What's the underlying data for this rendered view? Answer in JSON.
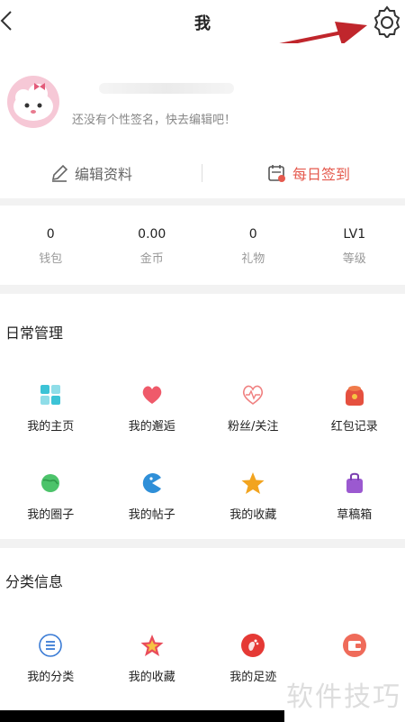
{
  "header": {
    "title": "我"
  },
  "profile": {
    "signature": "还没有个性签名，快去编辑吧！",
    "edit_label": "编辑资料",
    "checkin_label": "每日签到"
  },
  "stats": [
    {
      "value": "0",
      "label": "钱包"
    },
    {
      "value": "0.00",
      "label": "金币"
    },
    {
      "value": "0",
      "label": "礼物"
    },
    {
      "value": "LV1",
      "label": "等级"
    }
  ],
  "daily": {
    "title": "日常管理",
    "items": [
      {
        "label": "我的主页",
        "icon": "home-grid-icon"
      },
      {
        "label": "我的邂逅",
        "icon": "heart-icon"
      },
      {
        "label": "粉丝/关注",
        "icon": "heartbeat-icon"
      },
      {
        "label": "红包记录",
        "icon": "red-packet-icon"
      },
      {
        "label": "我的圈子",
        "icon": "planet-icon"
      },
      {
        "label": "我的帖子",
        "icon": "pacman-icon"
      },
      {
        "label": "我的收藏",
        "icon": "star-icon"
      },
      {
        "label": "草稿箱",
        "icon": "bag-icon"
      }
    ]
  },
  "category": {
    "title": "分类信息",
    "items": [
      {
        "label": "我的分类",
        "icon": "list-icon"
      },
      {
        "label": "我的收藏",
        "icon": "star-badge-icon"
      },
      {
        "label": "我的足迹",
        "icon": "footprint-icon"
      },
      {
        "label": "",
        "icon": "wallet-icon"
      }
    ]
  },
  "watermark": "软件技巧",
  "colors": {
    "accent": "#e55a4e",
    "arrow": "#c0262c"
  }
}
